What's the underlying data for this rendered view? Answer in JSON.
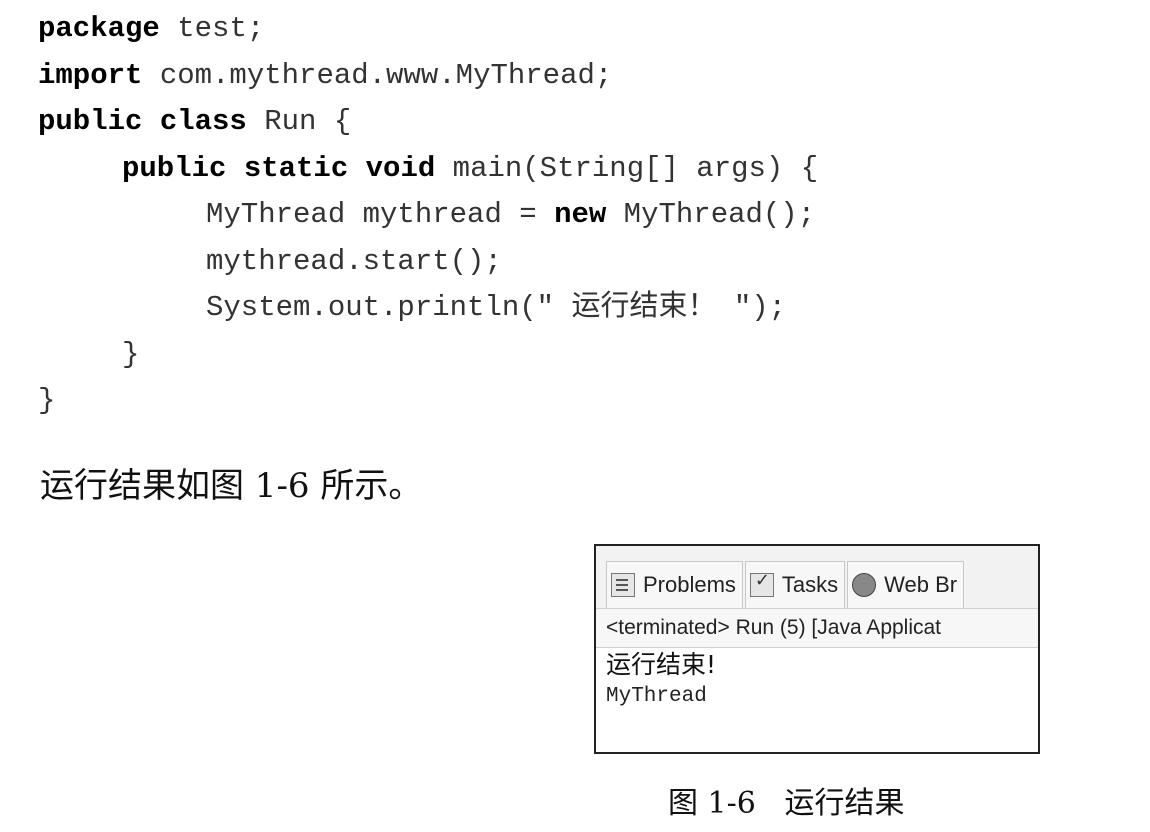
{
  "code": {
    "line1": {
      "kw": "package",
      "rest": " test;"
    },
    "line2": {
      "kw": "import",
      "rest": " com.mythread.www.MyThread;"
    },
    "line3": {
      "kw": "public class",
      "rest": " Run {"
    },
    "line4": {
      "kw": "public static void",
      "rest": " main(String[] args) {"
    },
    "line5": {
      "pre": "MyThread mythread = ",
      "kw": "new",
      "post": " MyThread();"
    },
    "line6": "mythread.start();",
    "line7": "System.out.println(\" 运行结束！ \");",
    "line8": "}",
    "line9": "}"
  },
  "paragraph": "运行结果如图 1-6 所示。",
  "figure": {
    "tabs": [
      {
        "label": "Problems",
        "icon": "problems-icon"
      },
      {
        "label": "Tasks",
        "icon": "tasks-icon"
      },
      {
        "label": "Web Br",
        "icon": "globe-icon"
      }
    ],
    "console_header": "<terminated> Run (5) [Java Applicat",
    "output": [
      "运行结束!",
      "MyThread"
    ]
  },
  "caption": "图 1-6   运行结果"
}
